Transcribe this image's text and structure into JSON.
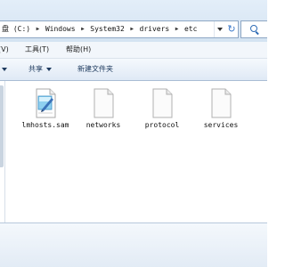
{
  "address_bar": {
    "crumbs": [
      "盘 (C:)",
      "Windows",
      "System32",
      "drivers",
      "etc"
    ],
    "separator": "▶",
    "go_glyph": "↻"
  },
  "search": {
    "icon": "search-icon"
  },
  "menu": {
    "items": [
      "(V)",
      "工具(T)",
      "帮助(H)"
    ]
  },
  "commands": {
    "share": "共享",
    "new_folder": "新建文件夹"
  },
  "files": [
    {
      "name": "lmhosts.sam",
      "icon": "notepad-document-icon"
    },
    {
      "name": "networks",
      "icon": "blank-document-icon"
    },
    {
      "name": "protocol",
      "icon": "blank-document-icon"
    },
    {
      "name": "services",
      "icon": "blank-document-icon"
    }
  ],
  "colors": {
    "toolbar": "#d4e3f2",
    "command_text": "#1e3a5e",
    "accent": "#2f6cb5"
  }
}
